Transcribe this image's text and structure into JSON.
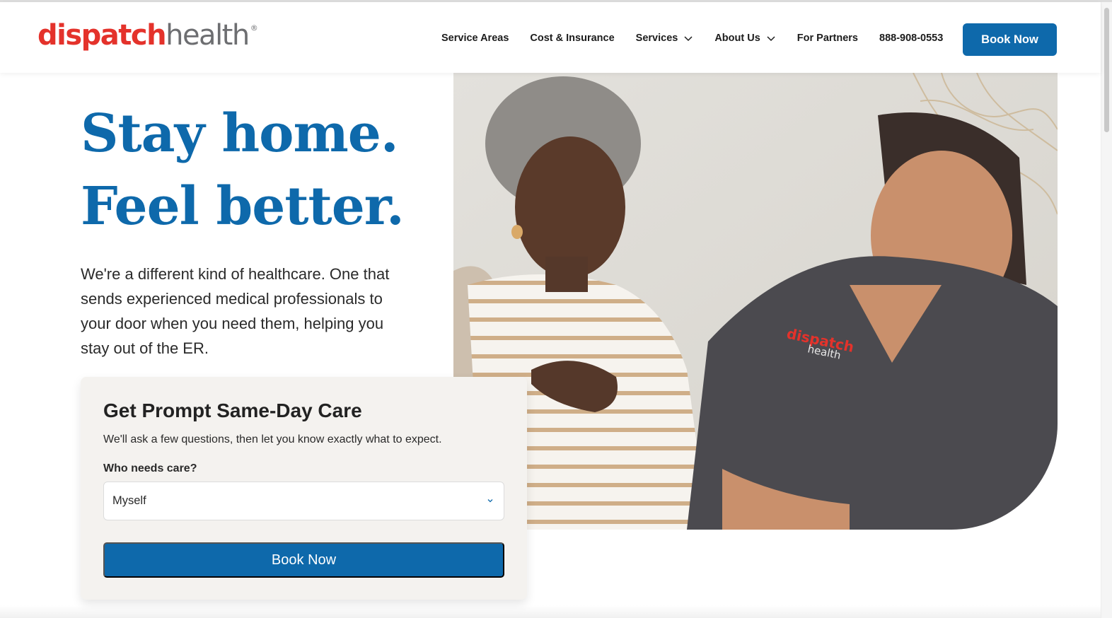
{
  "brand": {
    "logo_part1": "dispatch",
    "logo_part2": "health",
    "logo_mark": "®"
  },
  "nav": {
    "items": [
      {
        "label": "Service Areas",
        "dropdown": false
      },
      {
        "label": "Cost & Insurance",
        "dropdown": false
      },
      {
        "label": "Services",
        "dropdown": true
      },
      {
        "label": "About Us",
        "dropdown": true
      },
      {
        "label": "For Partners",
        "dropdown": false
      },
      {
        "label": "888-908-0553",
        "dropdown": false
      }
    ],
    "cta_label": "Book Now"
  },
  "hero": {
    "headline_line1": "Stay home.",
    "headline_line2": "Feel better.",
    "intro": "We're a different kind of healthcare. One that sends experienced medical professionals to your door when you need them, helping you stay out of the ER.",
    "photo_scrub_text_1": "dispatch",
    "photo_scrub_text_2": "health"
  },
  "booking_card": {
    "title": "Get Prompt Same-Day Care",
    "subtitle": "We'll ask a few questions, then let you know exactly what to expect.",
    "field_label": "Who needs care?",
    "select_value": "Myself",
    "button_label": "Book Now"
  },
  "colors": {
    "brand_blue": "#0e69ab",
    "brand_red": "#e4322b",
    "logo_gray": "#6d6e71",
    "card_bg": "#f4f2ef"
  },
  "icons": {
    "dropdown": "chevron-down-icon"
  }
}
